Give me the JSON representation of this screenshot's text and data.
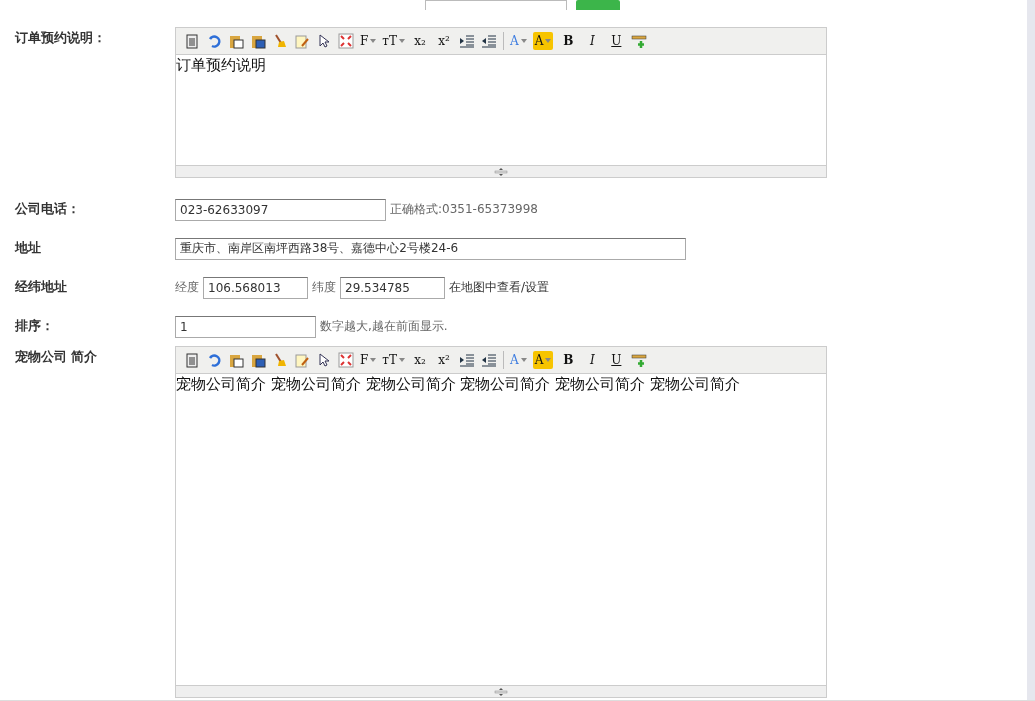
{
  "form": [
    {
      "kind": "editor",
      "label": "订单预约说明：",
      "content": "订单预约说明",
      "toolbar": [
        {
          "kind": "icon"
        },
        {
          "kind": "icon"
        },
        {
          "kind": "icon"
        },
        {
          "kind": "icon"
        },
        {
          "kind": "icon"
        },
        {
          "kind": "icon"
        },
        {
          "kind": "icon"
        },
        {
          "kind": "icon"
        },
        {
          "kind": "menu",
          "text": "F"
        },
        {
          "kind": "menu",
          "text": "тT"
        },
        {
          "kind": "glyph",
          "text": "x₂"
        },
        {
          "kind": "glyph",
          "text": "x²"
        },
        {
          "kind": "icon"
        },
        {
          "kind": "icon"
        },
        {
          "kind": "separator"
        },
        {
          "kind": "color",
          "text": "A"
        },
        {
          "kind": "highlight",
          "text": "A"
        },
        {
          "kind": "bold",
          "text": "B"
        },
        {
          "kind": "italic",
          "text": "I"
        },
        {
          "kind": "underline",
          "text": "U"
        },
        {
          "kind": "icon"
        }
      ]
    },
    {
      "kind": "input",
      "label": "公司电话：",
      "value": "023-62633097",
      "hint": "正确格式:0351-65373998"
    },
    {
      "kind": "input",
      "label": "地址",
      "value": "重庆市、南岸区南坪西路38号、嘉德中心2号楼24-6"
    },
    {
      "kind": "coords",
      "label": "经纬地址",
      "lng_label": "经度",
      "lng": "106.568013",
      "lat_label": "纬度",
      "lat": "29.534785",
      "link": "在地图中查看/设置"
    },
    {
      "kind": "input",
      "label": "排序：",
      "value": "1",
      "hint": "数字越大,越在前面显示."
    },
    {
      "kind": "editor",
      "label": "宠物公司 简介",
      "content": "宠物公司简介 宠物公司简介 宠物公司简介 宠物公司简介 宠物公司简介 宠物公司简介",
      "toolbar": [
        {
          "kind": "icon"
        },
        {
          "kind": "icon"
        },
        {
          "kind": "icon"
        },
        {
          "kind": "icon"
        },
        {
          "kind": "icon"
        },
        {
          "kind": "icon"
        },
        {
          "kind": "icon"
        },
        {
          "kind": "icon"
        },
        {
          "kind": "menu",
          "text": "F"
        },
        {
          "kind": "menu",
          "text": "тT"
        },
        {
          "kind": "glyph",
          "text": "x₂"
        },
        {
          "kind": "glyph",
          "text": "x²"
        },
        {
          "kind": "icon"
        },
        {
          "kind": "icon"
        },
        {
          "kind": "separator"
        },
        {
          "kind": "color",
          "text": "A"
        },
        {
          "kind": "highlight",
          "text": "A"
        },
        {
          "kind": "bold",
          "text": "B"
        },
        {
          "kind": "italic",
          "text": "I"
        },
        {
          "kind": "underline",
          "text": "U"
        },
        {
          "kind": "icon"
        }
      ]
    }
  ]
}
